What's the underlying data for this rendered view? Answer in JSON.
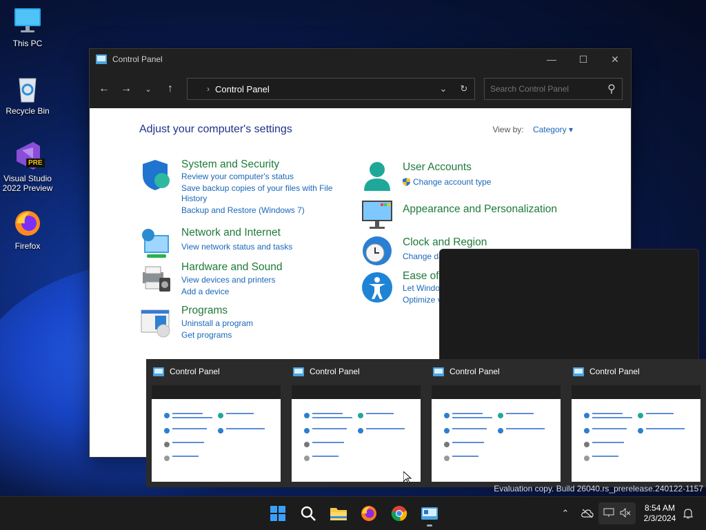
{
  "desktop": {
    "icons": [
      {
        "label": "This PC"
      },
      {
        "label": "Recycle Bin"
      },
      {
        "label": "Visual Studio 2022 Preview",
        "badge": "PRE"
      },
      {
        "label": "Firefox"
      }
    ]
  },
  "window": {
    "title": "Control Panel",
    "address_path": "Control Panel",
    "search_placeholder": "Search Control Panel",
    "heading": "Adjust your computer's settings",
    "view_by_label": "View by:",
    "view_by_value": "Category",
    "categories": [
      {
        "title": "System and Security",
        "links": [
          "Review your computer's status",
          "Save backup copies of your files with File History",
          "Backup and Restore (Windows 7)"
        ]
      },
      {
        "title": "Network and Internet",
        "links": [
          "View network status and tasks"
        ]
      },
      {
        "title": "Hardware and Sound",
        "links": [
          "View devices and printers",
          "Add a device"
        ]
      },
      {
        "title": "Programs",
        "links": [
          "Uninstall a program",
          "Get programs"
        ]
      },
      {
        "title": "User Accounts",
        "links": [
          "Change account type"
        ]
      },
      {
        "title": "Appearance and Personalization",
        "links": []
      },
      {
        "title": "Clock and Region",
        "links": [
          "Change da"
        ]
      },
      {
        "title": "Ease of",
        "links": [
          "Let Windo",
          "Optimize vi"
        ]
      }
    ]
  },
  "thumbnails": [
    {
      "title": "Control Panel"
    },
    {
      "title": "Control Panel"
    },
    {
      "title": "Control Panel"
    },
    {
      "title": "Control Panel"
    }
  ],
  "watermark": "Evaluation copy. Build 26040.rs_prerelease.240122-1157",
  "taskbar": {
    "apps": [
      "start-icon",
      "search-icon",
      "file-explorer-icon",
      "firefox-icon",
      "chrome-icon",
      "control-panel-icon"
    ],
    "time": "8:54 AM",
    "date": "2/3/2024"
  },
  "colors": {
    "heading": "#1e3287",
    "category_title": "#1e7a3a",
    "link": "#1a66b8",
    "titlebar": "#202020",
    "taskbar": "#1c1c1c"
  }
}
